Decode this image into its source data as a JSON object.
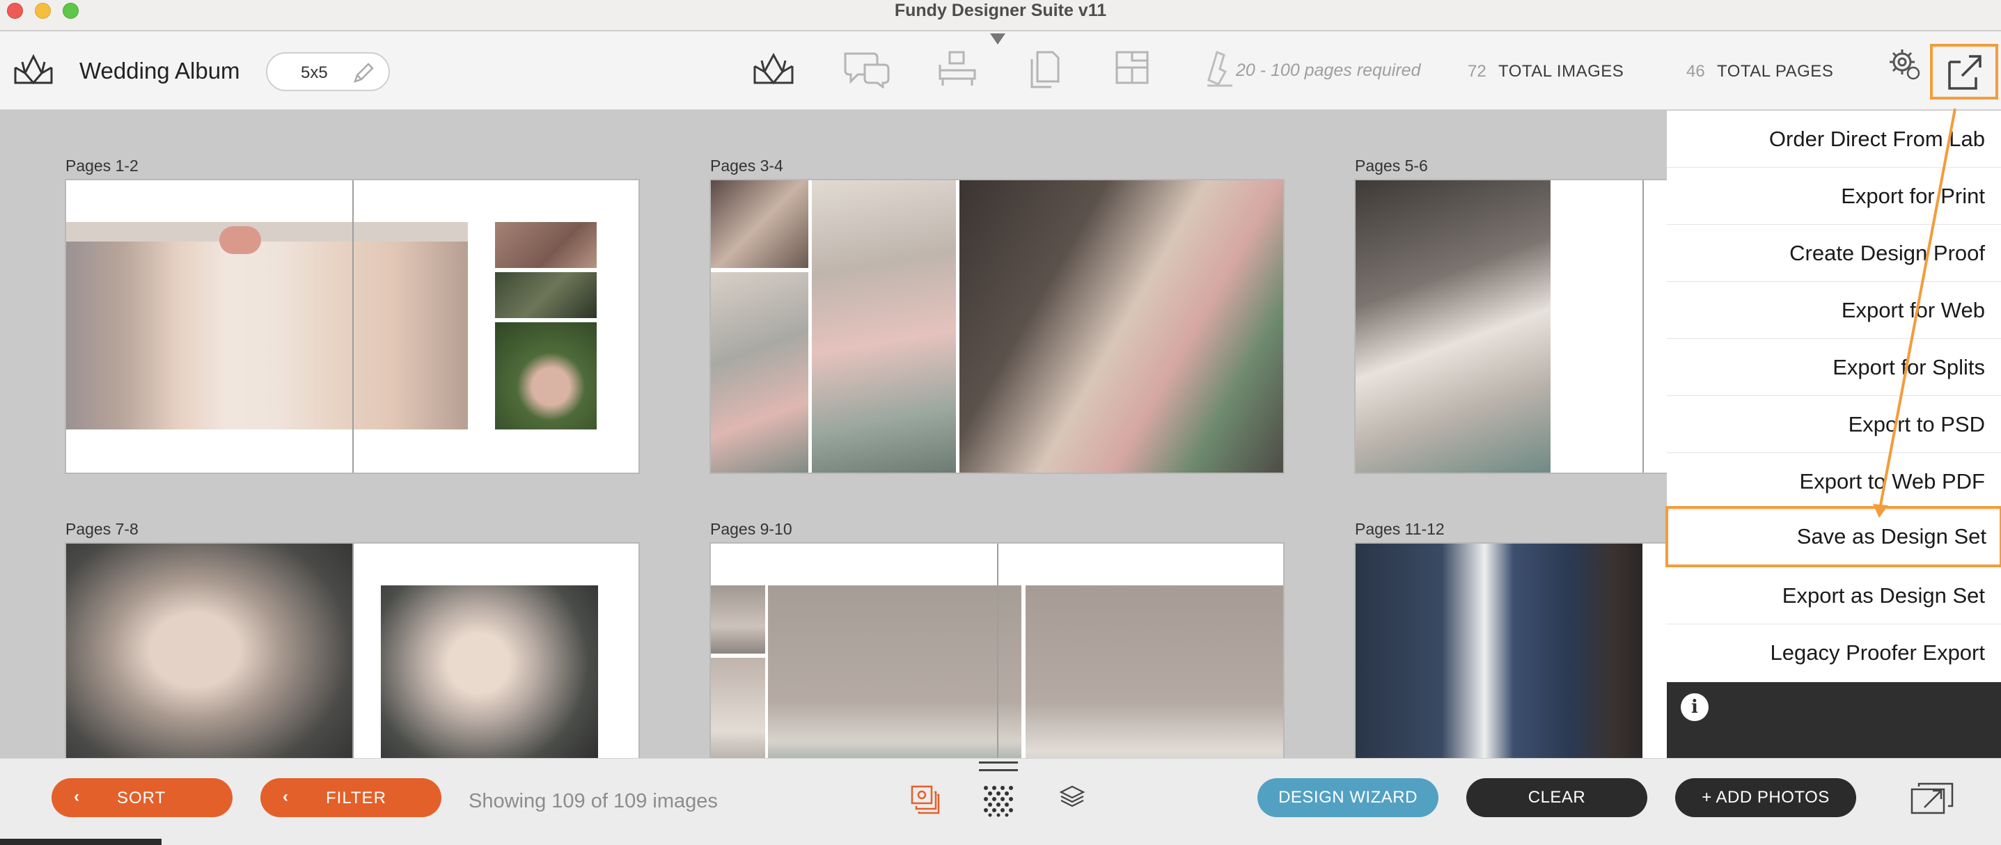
{
  "window": {
    "title": "Fundy Designer Suite v11"
  },
  "toolbar": {
    "album_name": "Wedding Album",
    "album_size": "5x5",
    "pages_required": "20 - 100 pages required",
    "total_images_count": "72",
    "total_images_label": "TOTAL IMAGES",
    "total_pages_count": "46",
    "total_pages_label": "TOTAL PAGES"
  },
  "spreads": [
    {
      "label": "Pages 1-2"
    },
    {
      "label": "Pages 3-4"
    },
    {
      "label": "Pages 5-6"
    },
    {
      "label": "Pages 7-8"
    },
    {
      "label": "Pages 9-10"
    },
    {
      "label": "Pages 11-12"
    }
  ],
  "export_menu": {
    "items": [
      {
        "label": "Order Direct From Lab"
      },
      {
        "label": "Export for Print"
      },
      {
        "label": "Create Design Proof"
      },
      {
        "label": "Export for Web"
      },
      {
        "label": "Export for Splits"
      },
      {
        "label": "Export to PSD"
      },
      {
        "label": "Export to Web PDF"
      },
      {
        "label": "Save as Design Set"
      },
      {
        "label": "Export as Design Set"
      },
      {
        "label": "Legacy Proofer Export"
      }
    ],
    "highlighted_item": "Save as Design Set"
  },
  "bottombar": {
    "sort_label": "SORT",
    "filter_label": "FILTER",
    "showing_text": "Showing 109 of 109 images",
    "design_wizard_label": "DESIGN WIZARD",
    "clear_label": "CLEAR",
    "add_photos_label": "+ ADD PHOTOS"
  },
  "colors": {
    "accent_orange": "#e4602a",
    "highlight_outline": "#f39c3b",
    "wizard_blue": "#52a1c3",
    "dark_button": "#2b2b2b"
  },
  "icons": [
    "album-design-icon",
    "pencil-icon",
    "proofing-chat-icon",
    "layout-furniture-icon",
    "pages-icon",
    "template-icon",
    "lab-stamp-icon",
    "settings-gear-icon",
    "export-arrow-icon",
    "info-icon",
    "chevron-left-icon",
    "image-stack-icon",
    "pattern-icon",
    "layers-icon",
    "external-display-icon"
  ]
}
